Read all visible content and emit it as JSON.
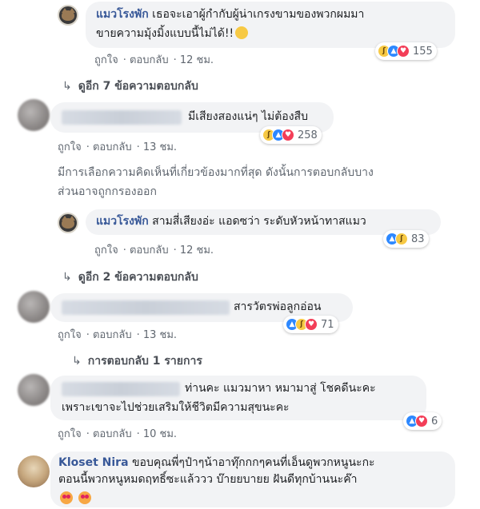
{
  "actions": {
    "like": "ถูกใจ",
    "reply": "ตอบกลับ"
  },
  "comments": [
    {
      "author": "แมวโรงพัก",
      "line1": "เธอจะเอาผู้กำกับผู้น่าเกรงขามของพวกผมมา",
      "line2": "ขายความมุ้งมิ้งแบบนี้ไม่ได้!!",
      "time": "12 ชม.",
      "reactions": [
        "haha",
        "like",
        "love"
      ],
      "count": "155"
    },
    {
      "author": "",
      "line1": "มีเสียงสองแน่ๆ ไม่ต้องสืบ",
      "time": "13 ชม.",
      "reactions": [
        "haha",
        "like",
        "love"
      ],
      "count": "258"
    },
    {
      "author": "แมวโรงพัก",
      "line1": "สามสี่เสียงอ่ะ แอดซว่า ระดับหัวหน้าทาสแมว",
      "time": "12 ชม.",
      "reactions": [
        "like",
        "haha"
      ],
      "count": "83"
    },
    {
      "author": "",
      "line1": "สารวัตรพ่อลูกอ่อน",
      "time": "13 ชม.",
      "reactions": [
        "like",
        "haha",
        "love"
      ],
      "count": "71"
    },
    {
      "author": "",
      "line1": "ท่านคะ แมวมาหา หมามาสู่ โชคดีนะคะ",
      "line2": "เพราะเขาจะไปช่วยเสริมให้ชีวิตมีความสุขนะคะ",
      "time": "10 ชม.",
      "reactions": [
        "like",
        "love"
      ],
      "count": "6"
    },
    {
      "author": "Kloset Nira",
      "line1": "ขอบคุณพี่ๆป๋าๆน้าอาทุ๊กกกๆคนที่เอ็นดูพวกหนูนะกะ",
      "line2": "ตอนนี้พวกหนูหมดฤทธิ์ซะแล้ววว บ๊ายยบายย ฝันดีทุกบ้านนะค๊า",
      "reactions": [],
      "count": ""
    }
  ],
  "more_replies": [
    "ดูอีก 7 ข้อความตอบกลับ",
    "ดูอีก 2 ข้อความตอบกลับ"
  ],
  "replies_one": "การตอบกลับ 1 รายการ",
  "filter_notice": {
    "line1": "มีการเลือกความคิดเห็นที่เกี่ยวข้องมากที่สุด ดังนั้นการตอบกลับบาง",
    "line2": "ส่วนอาจถูกกรองออก"
  },
  "colors": {
    "link": "#385898",
    "bubble": "#f2f3f5",
    "like": "#2d88ff",
    "love": "#f33e58",
    "haha": "#f7c944"
  }
}
